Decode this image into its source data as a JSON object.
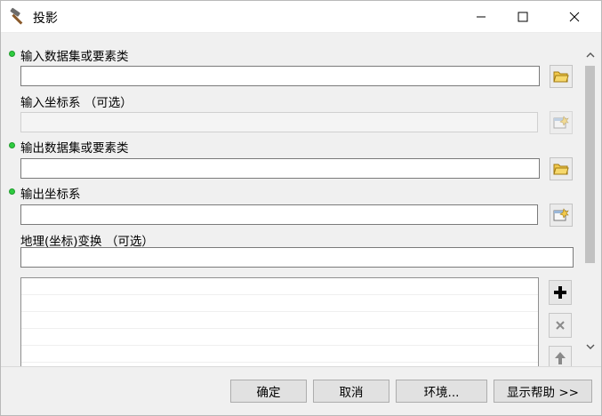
{
  "window": {
    "title": "投影",
    "icon": "hammer-icon",
    "controls": [
      "minimize-icon",
      "maximize-icon",
      "close-icon"
    ]
  },
  "form": {
    "input_dataset": {
      "label": "输入数据集或要素类",
      "value": "",
      "required": true,
      "button_icon": "open-folder-icon"
    },
    "input_cs": {
      "label": "输入坐标系 （可选）",
      "value": "",
      "required": false,
      "disabled": true,
      "button_icon": "spatial-reference-icon"
    },
    "output_dataset": {
      "label": "输出数据集或要素类",
      "value": "",
      "required": true,
      "button_icon": "open-folder-icon"
    },
    "output_cs": {
      "label": "输出坐标系",
      "value": "",
      "required": true,
      "button_icon": "spatial-reference-icon"
    },
    "geo_transform": {
      "label": "地理(坐标)变换 （可选）",
      "value": "",
      "required": false
    },
    "transform_list": {
      "rows": []
    },
    "list_buttons": [
      "add-icon",
      "remove-icon",
      "move-up-icon"
    ]
  },
  "footer": {
    "ok": "确定",
    "cancel": "取消",
    "environments": "环境...",
    "show_help": "显示帮助 >>"
  },
  "colors": {
    "required_dot": "#2ecc40",
    "window_bg": "#f0f0f0"
  }
}
